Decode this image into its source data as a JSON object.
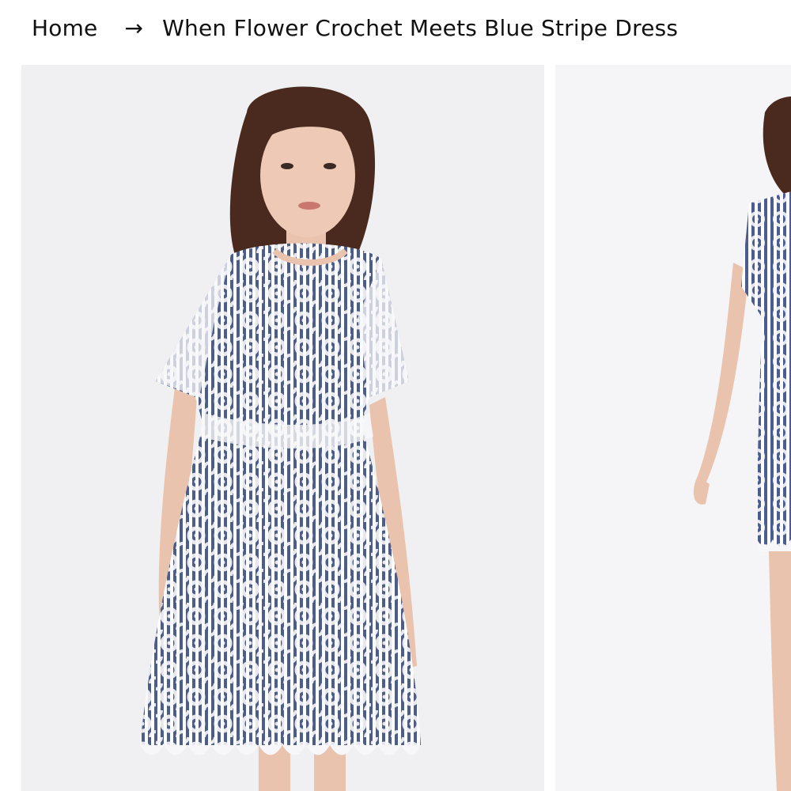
{
  "breadcrumb": {
    "home_label": "Home",
    "separator": "→",
    "current_label": "When Flower Crochet Meets Blue Stripe Dress"
  },
  "gallery": {
    "images": [
      {
        "alt": "Model wearing white floral crochet dress over blue stripe lining, front view"
      },
      {
        "alt": "Model wearing the dress, side view"
      }
    ]
  },
  "colors": {
    "lace": "#f4f4f6",
    "stripe_blue": "#4b5c8e",
    "background": "#f0f0f2",
    "skin": "#e9c3ad",
    "hair": "#4a2a1e"
  }
}
